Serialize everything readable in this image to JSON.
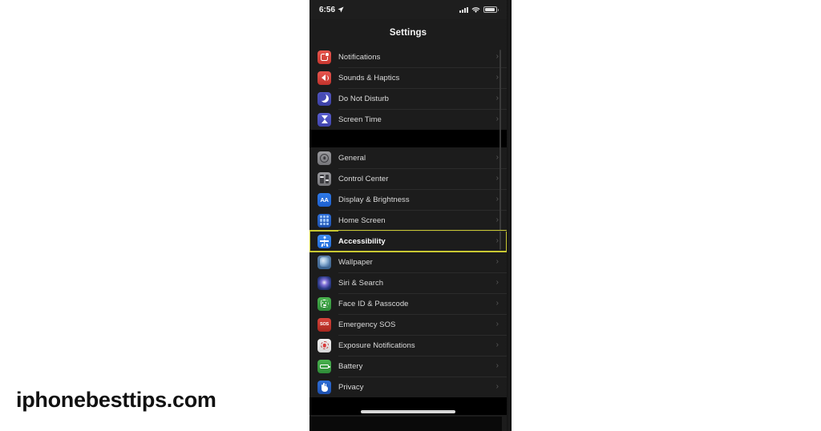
{
  "watermark": {
    "text": "iphonebesttips.com"
  },
  "phone": {
    "status_bar": {
      "time": "6:56",
      "location_icon": "location-arrow-icon",
      "cellular_icon": "cellular-signal-icon",
      "wifi_icon": "wifi-icon",
      "battery_icon": "battery-icon"
    },
    "nav": {
      "title": "Settings"
    },
    "chevron": "›",
    "highlight_color": "#c9c832",
    "groups": [
      {
        "rows": [
          {
            "label": "Notifications",
            "icon": "notifications-icon",
            "icon_color": "#d8433b",
            "highlighted": false
          },
          {
            "label": "Sounds & Haptics",
            "icon": "sounds-haptics-icon",
            "icon_color": "#d8433b",
            "highlighted": false
          },
          {
            "label": "Do Not Disturb",
            "icon": "do-not-disturb-icon",
            "icon_color": "#474bb4",
            "highlighted": false
          },
          {
            "label": "Screen Time",
            "icon": "screen-time-icon",
            "icon_color": "#4b50c2",
            "highlighted": false
          }
        ]
      },
      {
        "rows": [
          {
            "label": "General",
            "icon": "general-gear-icon",
            "icon_color": "#8a8a8e",
            "highlighted": false
          },
          {
            "label": "Control Center",
            "icon": "control-center-icon",
            "icon_color": "#8a8a8e",
            "highlighted": false
          },
          {
            "label": "Display & Brightness",
            "icon": "display-brightness-icon",
            "icon_color": "#2670de",
            "highlighted": false
          },
          {
            "label": "Home Screen",
            "icon": "home-screen-icon",
            "icon_color": "#255fc2",
            "highlighted": false
          },
          {
            "label": "Accessibility",
            "icon": "accessibility-icon",
            "icon_color": "#2f7ae6",
            "highlighted": true
          },
          {
            "label": "Wallpaper",
            "icon": "wallpaper-icon",
            "icon_color": "#4b739e",
            "highlighted": false
          },
          {
            "label": "Siri & Search",
            "icon": "siri-search-icon",
            "icon_color": "#2b3a86",
            "highlighted": false
          },
          {
            "label": "Face ID & Passcode",
            "icon": "face-id-passcode-icon",
            "icon_color": "#3b9f43",
            "highlighted": false
          },
          {
            "label": "Emergency SOS",
            "icon": "emergency-sos-icon",
            "icon_color": "#c0362e",
            "highlighted": false
          },
          {
            "label": "Exposure Notifications",
            "icon": "exposure-notifications-icon",
            "icon_color": "#e8e8e8",
            "highlighted": false
          },
          {
            "label": "Battery",
            "icon": "battery-settings-icon",
            "icon_color": "#3b9f43",
            "highlighted": false
          },
          {
            "label": "Privacy",
            "icon": "privacy-icon",
            "icon_color": "#255fc2",
            "highlighted": false
          }
        ]
      }
    ],
    "home_indicator": "home-indicator"
  }
}
